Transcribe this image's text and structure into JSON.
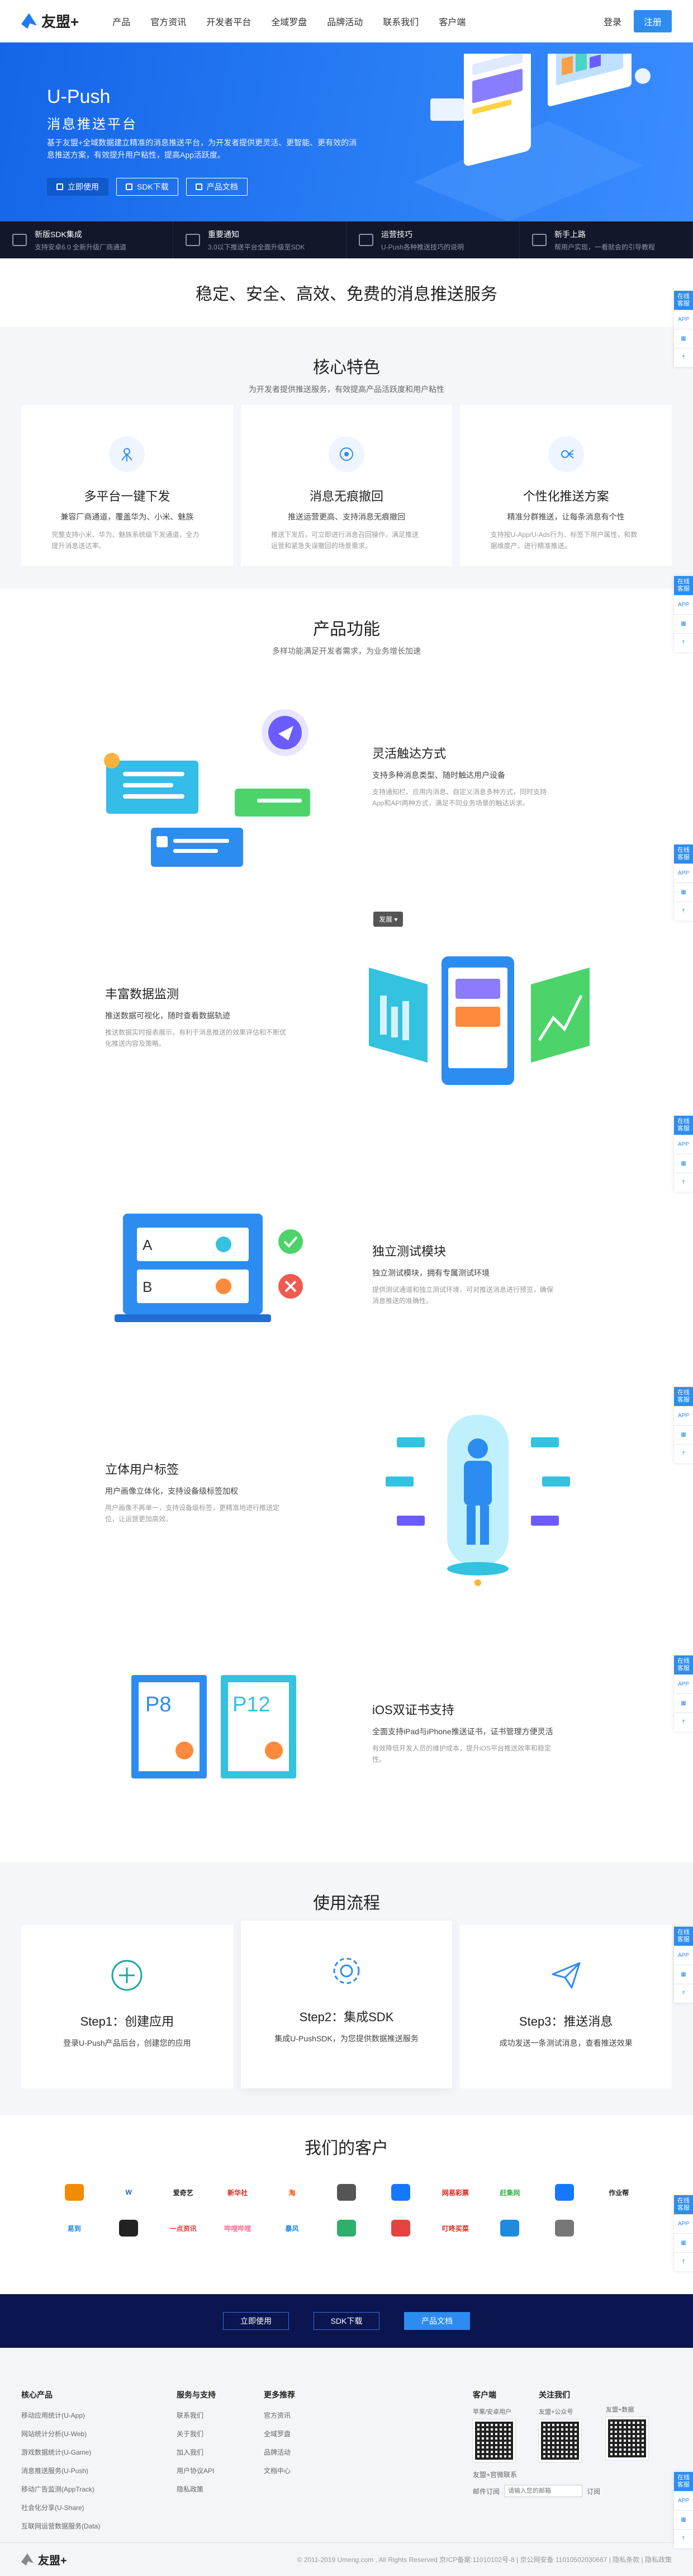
{
  "nav": {
    "brand": "友盟+",
    "links": [
      "产品",
      "官方资讯",
      "开发者平台",
      "全域罗盘",
      "品牌活动",
      "联系我们",
      "客户端"
    ],
    "login": "登录",
    "register": "注册"
  },
  "hero": {
    "title": "U-Push",
    "subtitle": "消息推送平台",
    "desc": "基于友盟+全域数据建立精准的消息推送平台，为开发者提供更灵活、更智能、更有效的消息推送方案，有效提升用户粘性，提高App活跃度。",
    "buttons": [
      "立即使用",
      "SDK下载",
      "产品文档"
    ]
  },
  "strip": [
    {
      "title": "新版SDK集成",
      "desc": "支持安卓6.0 全新升级厂商通道"
    },
    {
      "title": "重要通知",
      "desc": "3.0以下推送平台全面升级至SDK"
    },
    {
      "title": "运营技巧",
      "desc": "U-Push各种推送技巧的说明"
    },
    {
      "title": "新手上路",
      "desc": "帮用户实现，一看就会的引导教程"
    }
  ],
  "slogan": "稳定、安全、高效、免费的消息推送服务",
  "features": {
    "title": "核心特色",
    "subtitle": "为开发者提供推送服务，有效提高产品活跃度和用户粘性",
    "cards": [
      {
        "name": "多平台一键下发",
        "t1": "兼容厂商通道，覆盖华为、小米、魅族",
        "t2": "完整支持小米、华为、魅族系统级下发通道，全力提升消息送达率。"
      },
      {
        "name": "消息无痕撤回",
        "t1": "推送运营更高、支持消息无痕撤回",
        "t2": "推送下发后，可立即进行消息召回操作，满足推送运营和紧急失误撤回的场景需求。"
      },
      {
        "name": "个性化推送方案",
        "t1": "精准分群推送，让每条消息有个性",
        "t2": "支持按U-App/U-Ads行为、标签下用户属性，和数据维度产、进行精准推送。"
      }
    ]
  },
  "functions": {
    "title": "产品功能",
    "subtitle": "多样功能满足开发者需求，为业务增长加速",
    "tag": "发展",
    "items": [
      {
        "title": "灵活触达方式",
        "sub": "支持多种消息类型、随时触达用户设备",
        "desc": "支持通知栏、应用内消息、自定义消息多种方式，同时支持App和API两种方式，满足不同业务场景的触达诉求。"
      },
      {
        "title": "丰富数据监测",
        "sub": "推送数据可视化，随时查看数据轨迹",
        "desc": "推送数据实时报表展示，有利于消息推送的效果评估和不断优化推送内容及策略。"
      },
      {
        "title": "独立测试模块",
        "sub": "独立测试模块，拥有专属测试环境",
        "desc": "提供测试通道和独立测试环境，可对推送消息进行预览，确保消息推送的准确性。"
      },
      {
        "title": "立体用户标签",
        "sub": "用户画像立体化，支持设备级标签加权",
        "desc": "用户画像不再单一，支持设备级标签，更精准地进行推送定位，让运营更加高效。"
      },
      {
        "title": "iOS双证书支持",
        "sub": "全面支持iPad与iPhone推送证书，证书管理方便灵活",
        "desc": "有效降低开发人员的维护成本，提升iOS平台推送效率和稳定性。"
      }
    ]
  },
  "process": {
    "title": "使用流程",
    "steps": [
      {
        "step": "Step1：创建应用",
        "desc": "登录U-Push产品后台，创建您的应用"
      },
      {
        "step": "Step2：集成SDK",
        "desc": "集成U-PushSDK，为您提供数据推送服务"
      },
      {
        "step": "Step3：推送消息",
        "desc": "成功发送一条测试消息，查看推送效果"
      }
    ]
  },
  "customers": {
    "title": "我们的客户",
    "logos": [
      {
        "name": "",
        "color": "#f08c00"
      },
      {
        "name": "W",
        "color": "#1f5fbf"
      },
      {
        "name": "爱奇艺",
        "color": "#222"
      },
      {
        "name": "新华社",
        "color": "#d9261c"
      },
      {
        "name": "淘",
        "color": "#ff5000"
      },
      {
        "name": "",
        "color": "#555"
      },
      {
        "name": "",
        "color": "#1677ff"
      },
      {
        "name": "网易彩票",
        "color": "#d9261c"
      },
      {
        "name": "赶集网",
        "color": "#39b54a"
      },
      {
        "name": "",
        "color": "#1677ff"
      },
      {
        "name": "作业帮",
        "color": "#222"
      },
      {
        "name": "易到",
        "color": "#1e88e5"
      },
      {
        "name": "",
        "color": "#222"
      },
      {
        "name": "一点资讯",
        "color": "#e64340"
      },
      {
        "name": "哔哩哔哩",
        "color": "#fb7299"
      },
      {
        "name": "暴风",
        "color": "#1d8ce0"
      },
      {
        "name": "",
        "color": "#2eaf6b"
      },
      {
        "name": "",
        "color": "#e64340"
      },
      {
        "name": "叮咚买菜",
        "color": "#d9261c"
      },
      {
        "name": "",
        "color": "#1d8ce0"
      },
      {
        "name": "",
        "color": "#777"
      }
    ]
  },
  "cta": {
    "buttons": [
      "立即使用",
      "SDK下载",
      "产品文档"
    ]
  },
  "footer": {
    "col1": {
      "title": "核心产品",
      "items": [
        "移动应用统计(U-App)",
        "网站统计分析(U-Web)",
        "游戏数据统计(U-Game)",
        "消息推送服务(U-Push)",
        "移动广告监测(AppTrack)",
        "社会化分享(U-Share)",
        "互联网运营数据服务(Data)"
      ]
    },
    "col2": {
      "title": "服务与支持",
      "items": [
        "联系我们",
        "关于我们",
        "加入我们",
        "用户协议API",
        "隐私政策"
      ]
    },
    "col3": {
      "title": "更多推荐",
      "items": [
        "官方资讯",
        "全域罗盘",
        "品牌活动",
        "文档中心"
      ]
    },
    "col4": {
      "title": "客户端",
      "qr": [
        "苹果/安卓用户",
        "友盟+公众号",
        "友盟+数据"
      ]
    },
    "col5": {
      "title": "关注我们"
    },
    "contacts": [
      "友盟+官微联系",
      "邮件订阅",
      "请输入您的邮箱",
      "订阅"
    ],
    "brand": "友盟+",
    "copyright": "© 2011-2019 Umeng.com , All Rights Reserved 京ICP备案:11010102号-8 | 京公网安备 11010502030667 | 隐私条款 | 隐私政策"
  },
  "side": {
    "top": "在线客服",
    "items": [
      "APP",
      "二维码",
      "返回"
    ]
  }
}
